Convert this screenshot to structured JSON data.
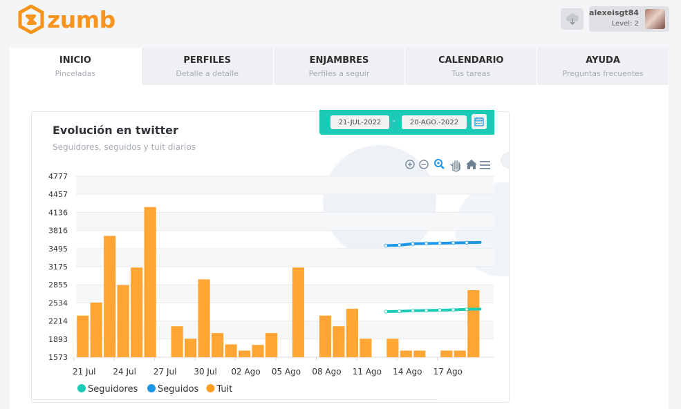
{
  "app": {
    "logo_text": "zumb",
    "logo_color": "#f7941d"
  },
  "header": {
    "cloud_icon": "cloud-download-icon",
    "user_name": "alexeisgt84",
    "user_level": "Level: 2"
  },
  "tabs": [
    {
      "label": "INICIO",
      "sub": "Pinceladas"
    },
    {
      "label": "PERFILES",
      "sub": "Detalle a detalle"
    },
    {
      "label": "ENJAMBRES",
      "sub": "Perfiles a seguir"
    },
    {
      "label": "CALENDARIO",
      "sub": "Tus tareas"
    },
    {
      "label": "AYUDA",
      "sub": "Preguntas frecuentes"
    }
  ],
  "date_range": {
    "from": "21-JUL-2022",
    "sep": "-",
    "to": "20-AGO.-2022"
  },
  "card": {
    "title": "Evolución en twitter",
    "subtitle": "Seguidores, seguidos y tuit diarios"
  },
  "toolbar": {
    "icons": [
      "zoom-in-icon",
      "zoom-out-icon",
      "selection-zoom-icon",
      "pan-hand-icon",
      "home-reset-icon",
      "menu-icon"
    ]
  },
  "colors": {
    "accent": "#1ccbb7",
    "tuit": "#ffa534",
    "seguidores": "#1ccbb7",
    "seguidos": "#1e96e8"
  },
  "chart_data": {
    "type": "bar",
    "title": "",
    "y_ticks": [
      "4777",
      "4457",
      "4136",
      "3816",
      "3495",
      "3175",
      "2855",
      "2534",
      "2214",
      "1893",
      "1573"
    ],
    "ylim": [
      1573,
      4777
    ],
    "x_tick_labels": [
      {
        "day": 1,
        "label": "21 Jul"
      },
      {
        "day": 4,
        "label": "24 Jul"
      },
      {
        "day": 7,
        "label": "27 Jul"
      },
      {
        "day": 10,
        "label": "30 Jul"
      },
      {
        "day": 13,
        "label": "02 Ago"
      },
      {
        "day": 16,
        "label": "05 Ago"
      },
      {
        "day": 19,
        "label": "08 Ago"
      },
      {
        "day": 22,
        "label": "11 Ago"
      },
      {
        "day": 25,
        "label": "14 Ago"
      },
      {
        "day": 28,
        "label": "17 Ago"
      }
    ],
    "series": [
      {
        "name": "Tuit",
        "type": "bar",
        "color": "#ffa534",
        "values": [
          2310,
          2540,
          3720,
          2850,
          3160,
          4230,
          null,
          2120,
          1900,
          2950,
          2000,
          1800,
          1690,
          1790,
          2000,
          null,
          3160,
          null,
          2310,
          2120,
          2430,
          1900,
          null,
          1900,
          1690,
          1690,
          null,
          1690,
          1690,
          2760
        ]
      },
      {
        "name": "Seguidores",
        "type": "line",
        "color": "#1ccbb7",
        "values": [
          null,
          null,
          null,
          null,
          null,
          null,
          null,
          null,
          null,
          null,
          null,
          null,
          null,
          null,
          null,
          null,
          null,
          null,
          null,
          null,
          null,
          null,
          null,
          2380,
          2385,
          2395,
          2400,
          2405,
          2410,
          2420,
          2425
        ]
      },
      {
        "name": "Seguidos",
        "type": "line",
        "color": "#1e96e8",
        "values": [
          null,
          null,
          null,
          null,
          null,
          null,
          null,
          null,
          null,
          null,
          null,
          null,
          null,
          null,
          null,
          null,
          null,
          null,
          null,
          null,
          null,
          null,
          null,
          3548,
          3555,
          3580,
          3585,
          3590,
          3595,
          3600,
          3605
        ]
      }
    ],
    "legend": {
      "placement": "bottom-left",
      "items": [
        {
          "label": "Seguidores",
          "color": "#1ccbb7"
        },
        {
          "label": "Seguidos",
          "color": "#1e96e8"
        },
        {
          "label": "Tuit",
          "color": "#ff9d26"
        }
      ]
    }
  }
}
